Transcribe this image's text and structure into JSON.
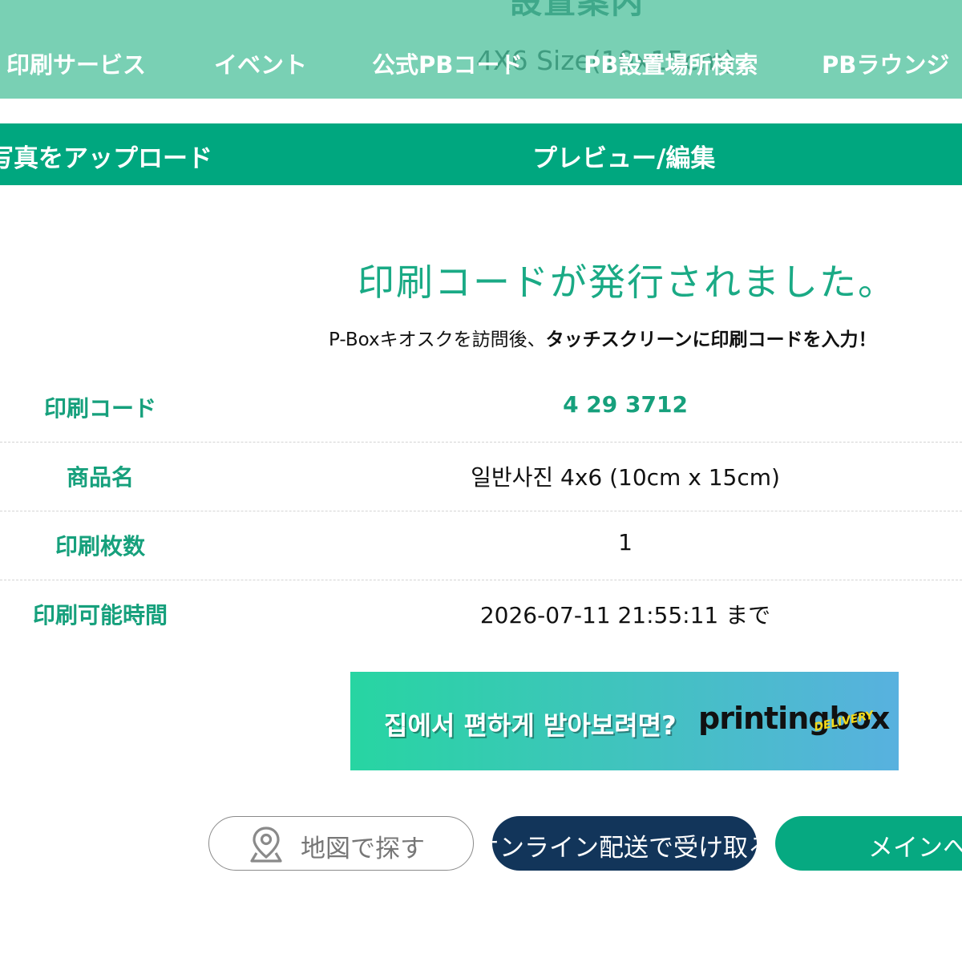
{
  "header": {
    "ghost_title": "設置案内",
    "ghost_subtitle": "4X6 Size(10x15cm)",
    "nav": [
      {
        "label": "印刷サービス"
      },
      {
        "label": "イベント"
      },
      {
        "label": "公式PBコード"
      },
      {
        "label": "PB設置場所検索"
      },
      {
        "label": "PBラウンジ"
      }
    ]
  },
  "steps": [
    {
      "label": "写真をアップロード"
    },
    {
      "label": "プレビュー/編集"
    }
  ],
  "result": {
    "headline": "印刷コードが発行されました。",
    "instruction_prefix": "P-Boxキオスクを訪問後、",
    "instruction_bold": "タッチスクリーンに印刷コードを入力！"
  },
  "info": [
    {
      "label": "印刷コード",
      "value": "4 29 3712"
    },
    {
      "label": "商品名",
      "value": "일반사진 4x6 (10cm x 15cm)"
    },
    {
      "label": "印刷枚数",
      "value": "1"
    },
    {
      "label": "印刷可能時間",
      "value": "2026-07-11 21:55:11 まで"
    }
  ],
  "banner": {
    "text": "집에서 편하게 받아보려면?",
    "brand": "printingbox",
    "brand_tag": "DELIVERY"
  },
  "buttons": {
    "map": {
      "label": "地図で探す",
      "icon": "map-pin-icon"
    },
    "delivery": {
      "label": "オンライン配送で受け取る"
    },
    "main": {
      "label": "メインへ"
    }
  },
  "colors": {
    "nav_bg": "#79d0b4",
    "steps_bg": "#00a77f",
    "accent": "#16a07c",
    "delivery_btn": "#12355a",
    "main_btn": "#06a981"
  }
}
